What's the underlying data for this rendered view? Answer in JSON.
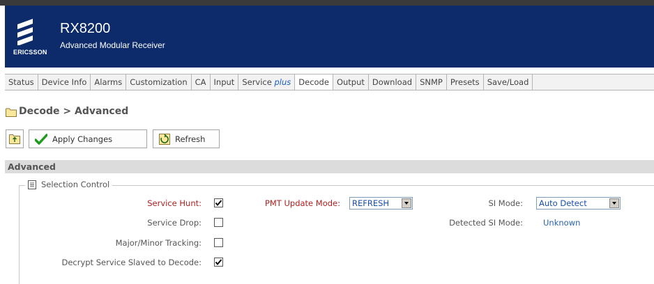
{
  "header": {
    "brand": "ERICSSON",
    "product_name": "RX8200",
    "product_subtitle": "Advanced Modular Receiver"
  },
  "tabs": [
    {
      "label": "Status"
    },
    {
      "label": "Device Info"
    },
    {
      "label": "Alarms"
    },
    {
      "label": "Customization"
    },
    {
      "label": "CA"
    },
    {
      "label": "Input"
    },
    {
      "label": "Service ",
      "suffix": "plus"
    },
    {
      "label": "Decode",
      "active": true
    },
    {
      "label": "Output"
    },
    {
      "label": "Download"
    },
    {
      "label": "SNMP"
    },
    {
      "label": "Presets"
    },
    {
      "label": "Save/Load"
    }
  ],
  "breadcrumb": "Decode > Advanced",
  "toolbar": {
    "apply_label": "Apply Changes",
    "refresh_label": "Refresh"
  },
  "section": {
    "title": "Advanced",
    "group_title": "Selection Control"
  },
  "fields": {
    "service_hunt": {
      "label": "Service Hunt:",
      "checked": true
    },
    "service_drop": {
      "label": "Service Drop:",
      "checked": false
    },
    "major_minor": {
      "label": "Major/Minor Tracking:",
      "checked": false
    },
    "decrypt_slaved": {
      "label": "Decrypt Service Slaved to Decode:",
      "checked": true
    },
    "pmt_update_mode": {
      "label": "PMT Update Mode:",
      "value": "REFRESH"
    },
    "si_mode": {
      "label": "SI Mode:",
      "value": "Auto Detect"
    },
    "detected_si_mode": {
      "label": "Detected SI Mode:",
      "value": "Unknown"
    }
  },
  "colors": {
    "header_bg": "#0d2b6b",
    "required_label": "#b02020",
    "value_blue": "#2a62b0",
    "apply_check": "#1f9a1f"
  }
}
